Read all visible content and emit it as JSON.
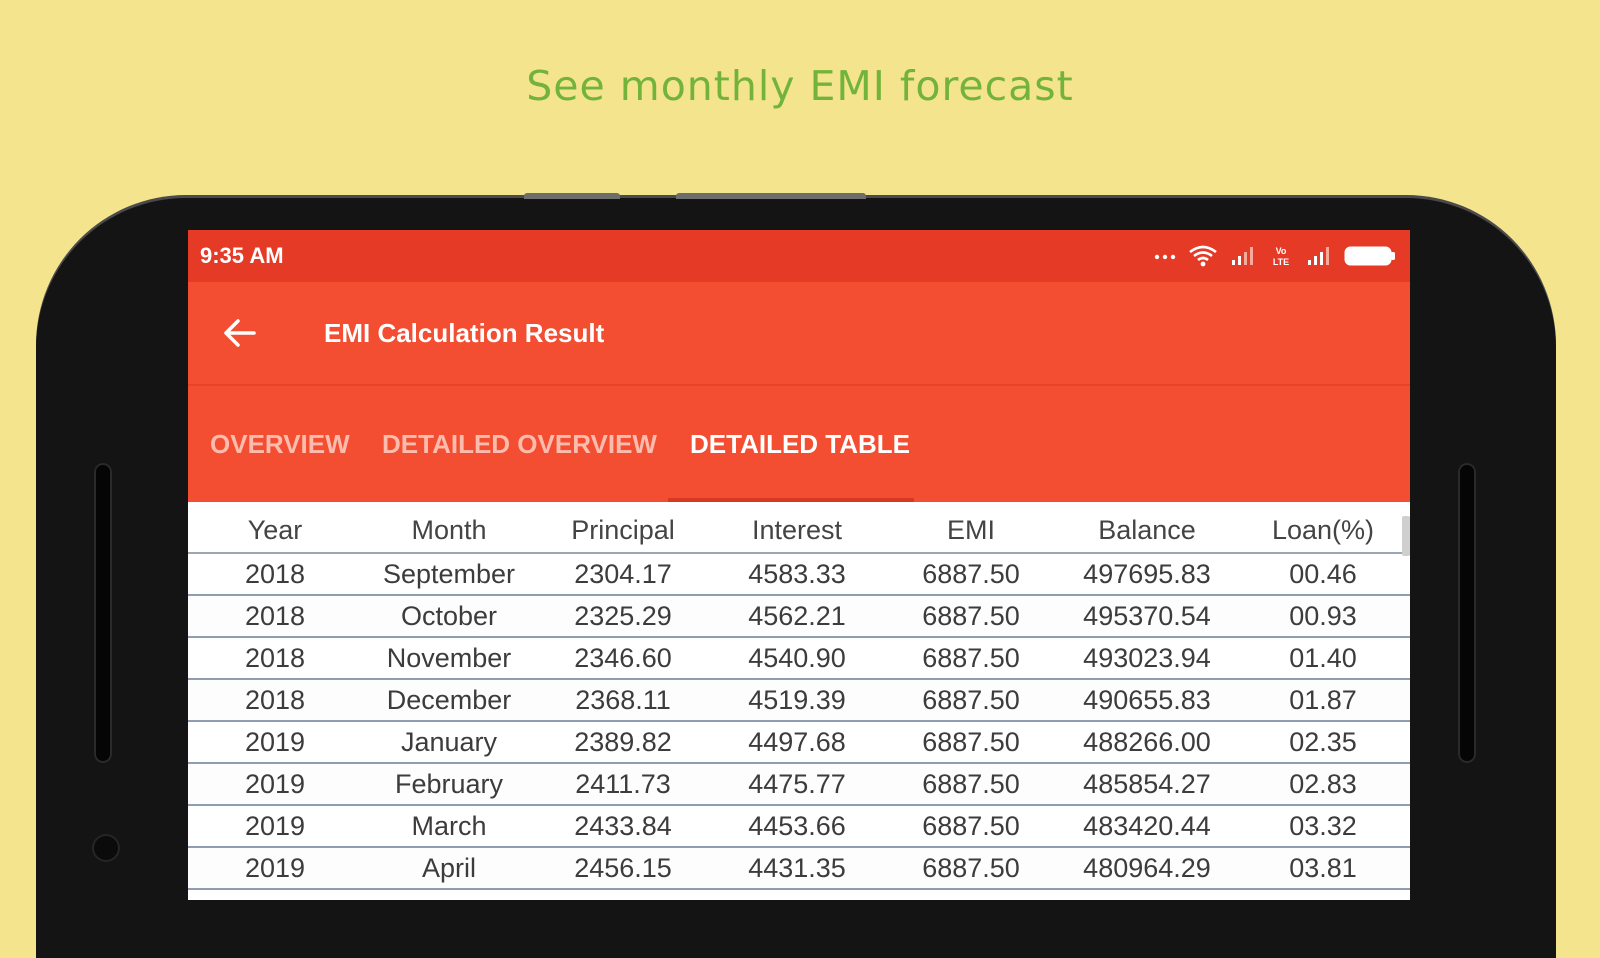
{
  "promo": {
    "caption": "See monthly EMI forecast"
  },
  "status_bar": {
    "time": "9:35 AM",
    "icons": [
      "more-dots-icon",
      "wifi-icon",
      "signal-icon",
      "volte-icon",
      "signal-icon",
      "battery-icon"
    ],
    "volte_text": "Vo LTE"
  },
  "app_bar": {
    "title": "EMI Calculation Result",
    "back_icon": "arrow-left-icon"
  },
  "tabs": [
    {
      "label": "OVERVIEW",
      "active": false
    },
    {
      "label": "DETAILED OVERVIEW",
      "active": false
    },
    {
      "label": "DETAILED TABLE",
      "active": true
    }
  ],
  "table": {
    "headers": [
      "Year",
      "Month",
      "Principal",
      "Interest",
      "EMI",
      "Balance",
      "Loan(%)"
    ],
    "rows": [
      [
        "2018",
        "September",
        "2304.17",
        "4583.33",
        "6887.50",
        "497695.83",
        "00.46"
      ],
      [
        "2018",
        "October",
        "2325.29",
        "4562.21",
        "6887.50",
        "495370.54",
        "00.93"
      ],
      [
        "2018",
        "November",
        "2346.60",
        "4540.90",
        "6887.50",
        "493023.94",
        "01.40"
      ],
      [
        "2018",
        "December",
        "2368.11",
        "4519.39",
        "6887.50",
        "490655.83",
        "01.87"
      ],
      [
        "2019",
        "January",
        "2389.82",
        "4497.68",
        "6887.50",
        "488266.00",
        "02.35"
      ],
      [
        "2019",
        "February",
        "2411.73",
        "4475.77",
        "6887.50",
        "485854.27",
        "02.83"
      ],
      [
        "2019",
        "March",
        "2433.84",
        "4453.66",
        "6887.50",
        "483420.44",
        "03.32"
      ],
      [
        "2019",
        "April",
        "2456.15",
        "4431.35",
        "6887.50",
        "480964.29",
        "03.81"
      ]
    ]
  },
  "colors": {
    "background": "#f5e48e",
    "caption": "#72b43b",
    "status_bar": "#e53a26",
    "app_bar": "#f44e32",
    "tab_inactive": "#fbbcae",
    "tab_active": "#ffffff"
  }
}
